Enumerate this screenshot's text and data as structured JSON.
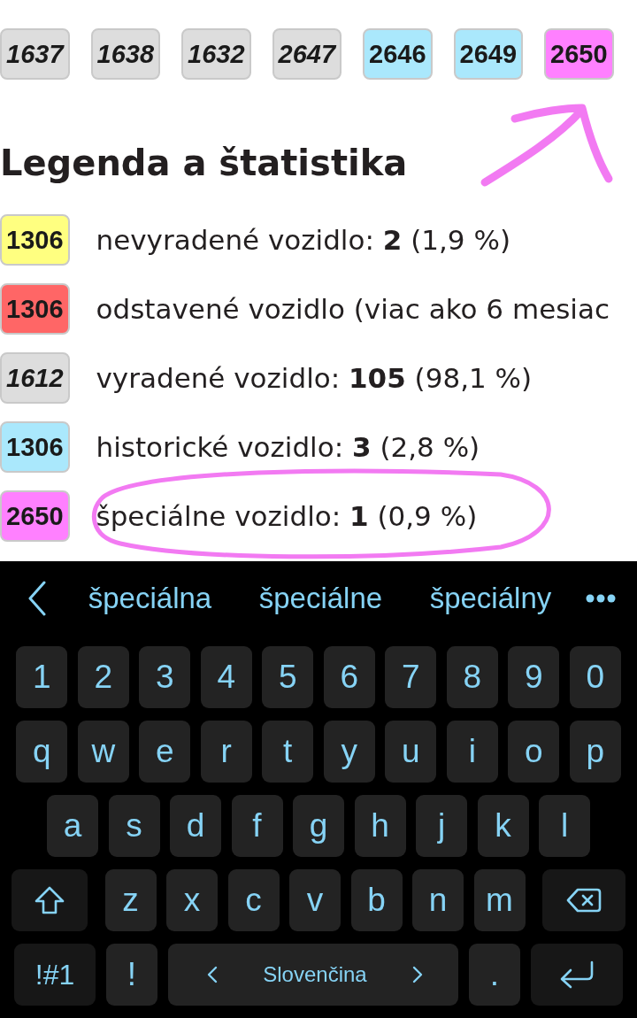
{
  "vehicle_badges": [
    {
      "number": "1637",
      "kind": "retired",
      "color": "#dddddd"
    },
    {
      "number": "1638",
      "kind": "retired",
      "color": "#dddddd"
    },
    {
      "number": "1632",
      "kind": "retired",
      "color": "#dddddd"
    },
    {
      "number": "2647",
      "kind": "retired",
      "color": "#dddddd"
    },
    {
      "number": "2646",
      "kind": "historic",
      "color": "#aae8fc"
    },
    {
      "number": "2649",
      "kind": "historic",
      "color": "#aae8fc"
    },
    {
      "number": "2650",
      "kind": "special",
      "color": "#ff80ff"
    }
  ],
  "legend": {
    "title": "Legenda a štatistika",
    "items": [
      {
        "badge": {
          "number": "1306",
          "kind": "active",
          "color": "#ffff80"
        },
        "text": "nevyradené vozidlo: **2** (1,9 %)"
      },
      {
        "badge": {
          "number": "1306",
          "kind": "parked",
          "color": "#ff6666"
        },
        "text": "odstavené vozidlo (viac ako 6 mesiac"
      },
      {
        "badge": {
          "number": "1612",
          "kind": "retired",
          "color": "#dddddd"
        },
        "text": "vyradené vozidlo: **105** (98,1 %)"
      },
      {
        "badge": {
          "number": "1306",
          "kind": "historic",
          "color": "#aae8fc"
        },
        "text": "historické vozidlo: **3** (2,8 %)"
      },
      {
        "badge": {
          "number": "2650",
          "kind": "special",
          "color": "#ff80ff"
        },
        "text": "špeciálne vozidlo: **1** (0,9 %)"
      }
    ]
  },
  "keyboard": {
    "suggestions": [
      "špeciálna",
      "špeciálne",
      "špeciálny"
    ],
    "key_rows": [
      {
        "keys": [
          {
            "kind": "char",
            "label": "1"
          },
          {
            "kind": "char",
            "label": "2"
          },
          {
            "kind": "char",
            "label": "3"
          },
          {
            "kind": "char",
            "label": "4"
          },
          {
            "kind": "char",
            "label": "5"
          },
          {
            "kind": "char",
            "label": "6"
          },
          {
            "kind": "char",
            "label": "7"
          },
          {
            "kind": "char",
            "label": "8"
          },
          {
            "kind": "char",
            "label": "9"
          },
          {
            "kind": "char",
            "label": "0"
          }
        ]
      },
      {
        "keys": [
          {
            "kind": "char",
            "label": "q"
          },
          {
            "kind": "char",
            "label": "w"
          },
          {
            "kind": "char",
            "label": "e"
          },
          {
            "kind": "char",
            "label": "r"
          },
          {
            "kind": "char",
            "label": "t"
          },
          {
            "kind": "char",
            "label": "y"
          },
          {
            "kind": "char",
            "label": "u"
          },
          {
            "kind": "char",
            "label": "i"
          },
          {
            "kind": "char",
            "label": "o"
          },
          {
            "kind": "char",
            "label": "p"
          }
        ]
      },
      {
        "keys": [
          {
            "kind": "char",
            "label": "a"
          },
          {
            "kind": "char",
            "label": "s"
          },
          {
            "kind": "char",
            "label": "d"
          },
          {
            "kind": "char",
            "label": "f"
          },
          {
            "kind": "char",
            "label": "g"
          },
          {
            "kind": "char",
            "label": "h"
          },
          {
            "kind": "char",
            "label": "j"
          },
          {
            "kind": "char",
            "label": "k"
          },
          {
            "kind": "char",
            "label": "l"
          }
        ]
      },
      {
        "keys": [
          {
            "kind": "shift"
          },
          {
            "kind": "char",
            "label": "z"
          },
          {
            "kind": "char",
            "label": "x"
          },
          {
            "kind": "char",
            "label": "c"
          },
          {
            "kind": "char",
            "label": "v"
          },
          {
            "kind": "char",
            "label": "b"
          },
          {
            "kind": "char",
            "label": "n"
          },
          {
            "kind": "char",
            "label": "m"
          },
          {
            "kind": "backspace"
          }
        ]
      },
      {
        "keys": [
          {
            "kind": "symbols",
            "label": "!#1"
          },
          {
            "kind": "char",
            "label": "!"
          },
          {
            "kind": "space",
            "label": "Slovenčina"
          },
          {
            "kind": "char",
            "label": "."
          },
          {
            "kind": "enter"
          }
        ]
      }
    ]
  }
}
